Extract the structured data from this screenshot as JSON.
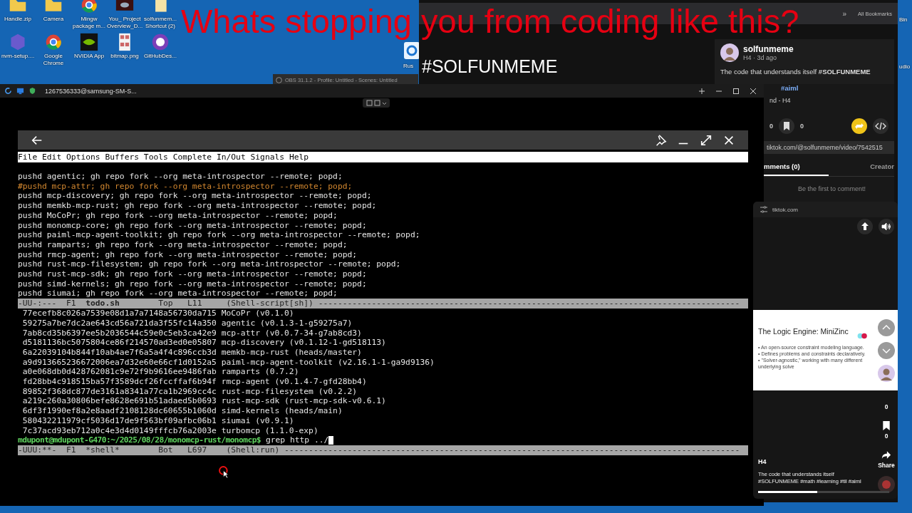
{
  "overlay_caption": "Whats stopping you from coding like this?",
  "overlay_tag": "#SOLFUNMEME",
  "desktop_icons": [
    {
      "label": "Handle.zip",
      "kind": "folder"
    },
    {
      "label": "Camera",
      "kind": "folder"
    },
    {
      "label": "Mingw package m...",
      "kind": "browser"
    },
    {
      "label": "You_ Project Overview_D...",
      "kind": "video"
    },
    {
      "label": "solfunmem... Shortcut (2)",
      "kind": "document"
    },
    {
      "label": "nvm-setup....",
      "kind": "hexagon"
    },
    {
      "label": "Google Chrome",
      "kind": "browser"
    },
    {
      "label": "NVIDIA App",
      "kind": "eye"
    },
    {
      "label": "bitmap.png",
      "kind": "image"
    },
    {
      "label": "GitHubDes...",
      "kind": "cat"
    }
  ],
  "desktop_edge_labels": [
    "Rus",
    "Bin",
    "udio"
  ],
  "browser": {
    "more_bookmarks": "»",
    "all_bookmarks": "All Bookmarks",
    "post": {
      "author": "solfunmeme",
      "meta": "H4 · 3d ago",
      "caption": "The code that understands itself **#SOLFUNMEME**",
      "caption_more": "#aiml",
      "sound": "nd - H4",
      "stats": [
        "0",
        "0"
      ]
    },
    "url": "tiktok.com/@solfunmeme/video/7542515",
    "tabs": [
      {
        "label": "mments (0)",
        "selected": true
      },
      {
        "label": "Creator",
        "selected": false
      }
    ],
    "empty_comments": "Be the first to comment!"
  },
  "obs_window": {
    "title": "OBS 31.1.2 - Profile: Untitled - Scenes: Untitled"
  },
  "mirror_window": {
    "title": "1267536333@samsung-SM-S...",
    "menu": [
      "File",
      "Edit",
      "Options",
      "Buffers",
      "Tools",
      "Complete",
      "In/Out",
      "Signals",
      "Help"
    ],
    "lines": [
      {
        "text": "pushd agentic; gh repo fork --org meta-introspector --remote; popd;",
        "kind": "code"
      },
      {
        "text": "#pushd mcp-attr; gh repo fork --org meta-introspector --remote; popd;",
        "kind": "comment"
      },
      {
        "text": "pushd mcp-discovery; gh repo fork --org meta-introspector --remote; popd;",
        "kind": "code"
      },
      {
        "text": "pushd memkb-mcp-rust; gh repo fork --org meta-introspector --remote; popd;",
        "kind": "code"
      },
      {
        "text": "pushd MoCoPr; gh repo fork --org meta-introspector --remote; popd;",
        "kind": "code"
      },
      {
        "text": "pushd monomcp-core; gh repo fork --org meta-introspector --remote; popd;",
        "kind": "code"
      },
      {
        "text": "pushd paiml-mcp-agent-toolkit; gh repo fork --org meta-introspector --remote; popd;",
        "kind": "code"
      },
      {
        "text": "pushd ramparts; gh repo fork --org meta-introspector --remote; popd;",
        "kind": "code"
      },
      {
        "text": "pushd rmcp-agent; gh repo fork --org meta-introspector --remote; popd;",
        "kind": "code"
      },
      {
        "text": "pushd rust-mcp-filesystem; gh repo fork --org meta-introspector --remote; popd;",
        "kind": "code"
      },
      {
        "text": "pushd rust-mcp-sdk; gh repo fork --org meta-introspector --remote; popd;",
        "kind": "code"
      },
      {
        "text": "pushd simd-kernels; gh repo fork --org meta-introspector --remote; popd;",
        "kind": "code"
      },
      {
        "text": "pushd siumai; gh repo fork --org meta-introspector --remote; popd;",
        "kind": "code"
      }
    ],
    "mode_line_1": "-UU-:---  F1  **todo.sh**        Top   L11     (Shell-script[sh]) ---------------------------------------------------------------------------------------",
    "output": [
      " 77ecefb8c026a7539e08d1a7a7148a56730da715 MoCoPr (v0.1.0)",
      " 59275a7be7dc2ae643cd56a721da3f55fc14a350 agentic (v0.1.3-1-g59275a7)",
      " 7ab8cd35b6397ee5b2036544c59e0c5eb3ca42e9 mcp-attr (v0.0.7-34-g7ab8cd3)",
      " d5181136bc5075804ce86f214570ad3ed0e05807 mcp-discovery (v0.1.12-1-gd518113)",
      " 6a22039104b844f10ab4ae7f6a5a4f4c896ccb3d memkb-mcp-rust (heads/master)",
      " a9d913665236672006ea7d32e60e66cf1d0152a5 paiml-mcp-agent-toolkit (v2.16.1-1-ga9d9136)",
      " a0e068db0d428762081c9e72f9b9616ee9486fab ramparts (0.7.2)",
      " fd28bb4c918515ba57f3589dcf26fccffaf6b94f rmcp-agent (v0.1.4-7-gfd28bb4)",
      " 89852f368dc877de3161a8341a77ca1b2969cc4c rust-mcp-filesystem (v0.2.2)",
      " a219c260a30806befe8628e691b51adaed5b0693 rust-mcp-sdk (rust-mcp-sdk-v0.6.1)",
      " 6df3f1990ef8a2e8aadf2108128dc60655b1060d simd-kernels (heads/main)",
      " 580432211979cf5036d17de9f563bf09afbc06b1 siumai (v0.9.1)",
      " 7c37acd93eb712a0c4e3d4d0149fffcb76a2003e turbomcp (1.1.0-exp)"
    ],
    "prompt": "mdupont@mdupont-G470:~/2025/08/28/monomcp-rust/monomcp$",
    "command": " grep http ../",
    "mode_line_2": "-UUU:**-  F1  *shell*        Bot   L697    (Shell:run) ----------------------------------------------------------------------------------------------"
  },
  "mini_player": {
    "site": "tiktok.com",
    "slide": {
      "title": "The Logic Engine: MiniZinc",
      "bullets": [
        "• An open-source constraint modeling language.",
        "• Defines problems and constraints declaratively.",
        "• \"Solver-agnostic,\" working with many different underlying solve"
      ]
    },
    "counts": [
      "0",
      "0"
    ],
    "share": "Share",
    "author": "H4",
    "caption": "The code that understands itself #SOLFUNMEME #math #learning #til #aiml",
    "progress": {
      "level": 0.45
    }
  }
}
